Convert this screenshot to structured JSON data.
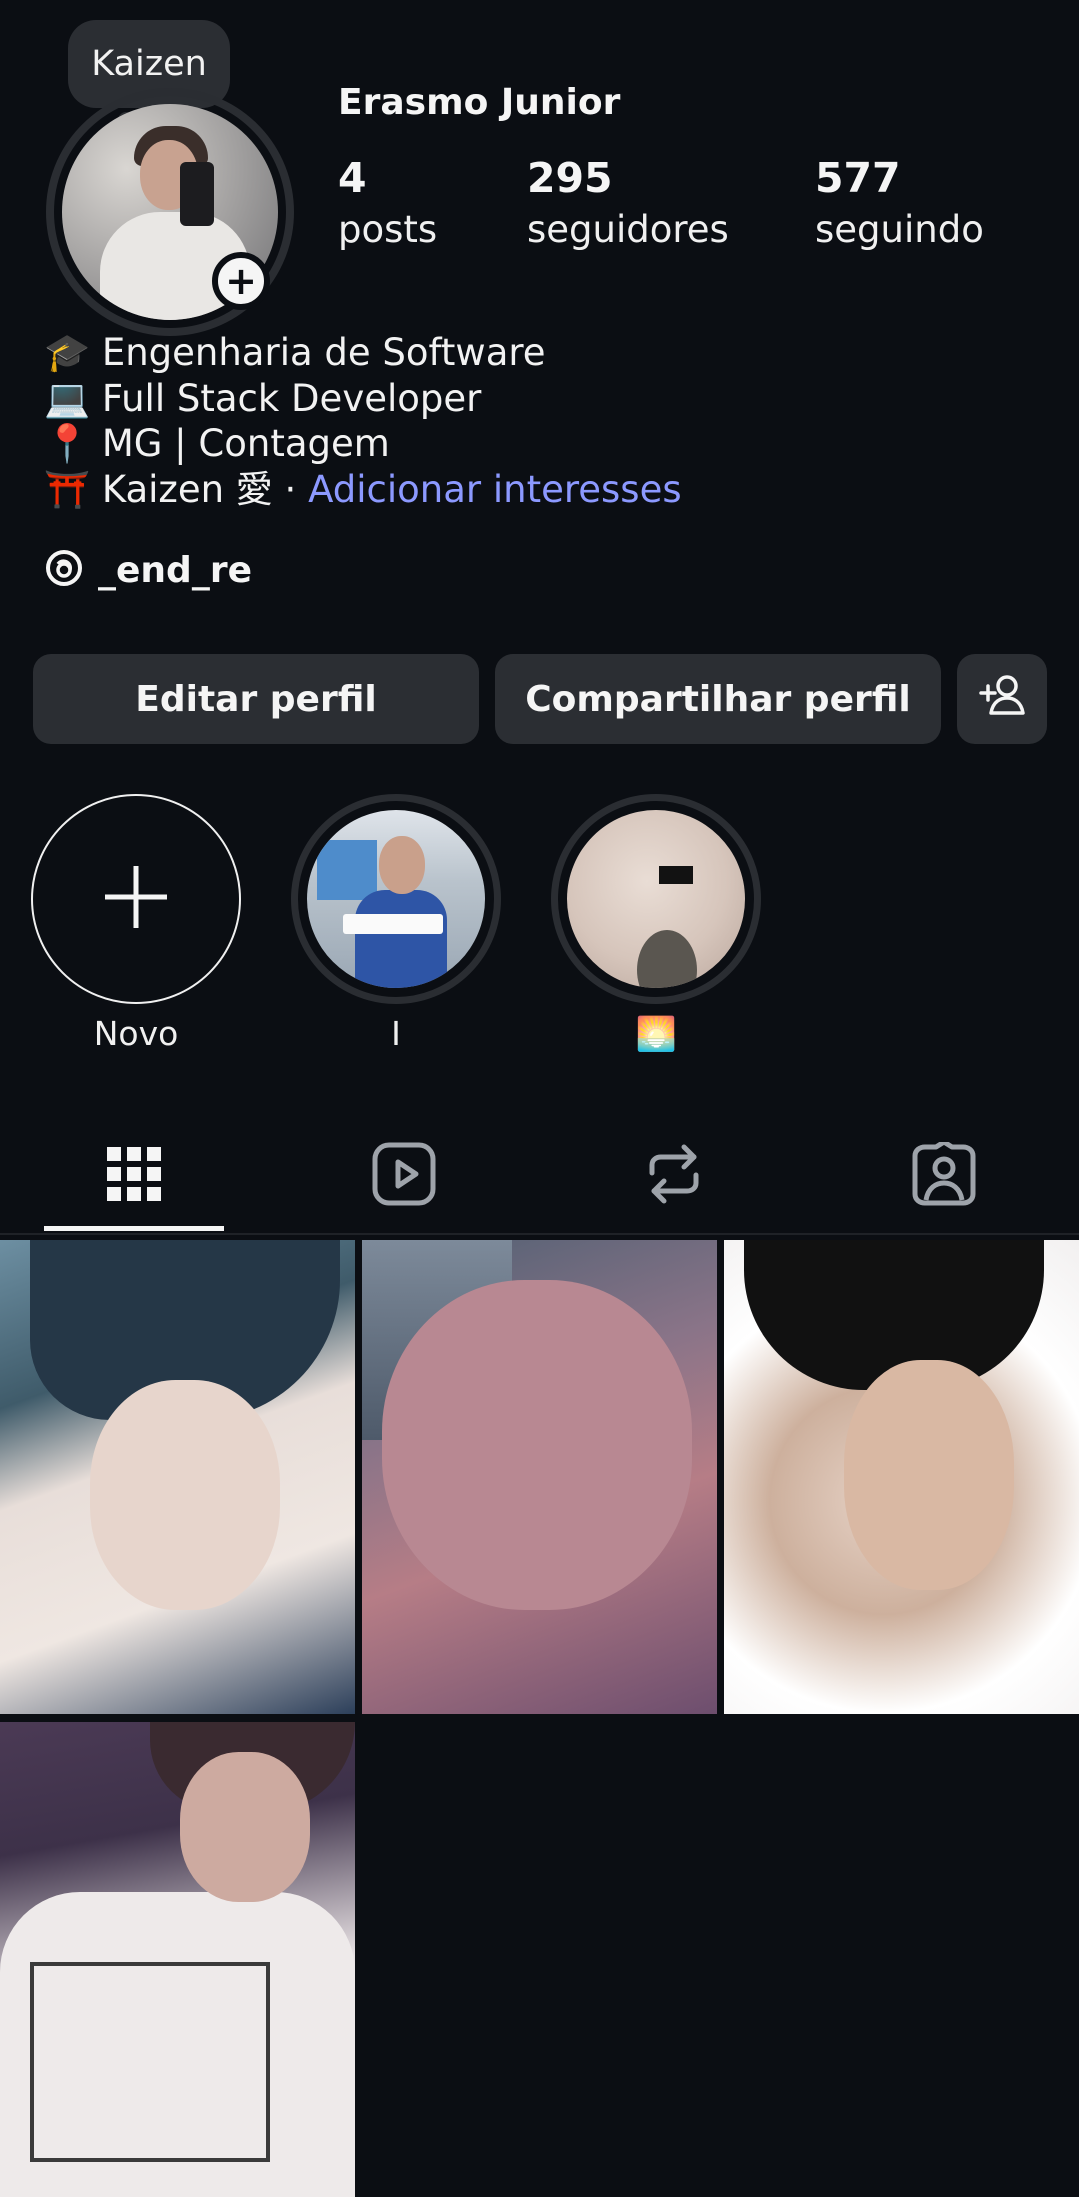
{
  "note": {
    "text": "Kaizen"
  },
  "profile": {
    "username": "Erasmo Junior",
    "stats": [
      {
        "value": "4",
        "label": "posts"
      },
      {
        "value": "295",
        "label": "seguidores"
      },
      {
        "value": "577",
        "label": "seguindo"
      }
    ],
    "bio": {
      "line1": "🎓 Engenharia de Software",
      "line2": "💻 Full Stack Developer",
      "line3": "📍 MG | Contagem",
      "line4_prefix": "⛩️ Kaizen 愛 · ",
      "line4_link": "Adicionar interesses"
    },
    "threads_handle": "_end_re"
  },
  "buttons": {
    "edit": "Editar perfil",
    "share": "Compartilhar perfil",
    "add_user_icon": "add-person-icon"
  },
  "highlights": [
    {
      "label": "Novo"
    },
    {
      "label": "I"
    },
    {
      "label": "🌅"
    }
  ],
  "tabs": [
    {
      "icon": "grid-icon",
      "active": true
    },
    {
      "icon": "reels-icon",
      "active": false
    },
    {
      "icon": "reposts-icon",
      "active": false
    },
    {
      "icon": "tagged-icon",
      "active": false
    }
  ],
  "posts_count_shown": 4,
  "colors": {
    "background": "#0b0e13",
    "button": "#2b2e33",
    "link": "#8c99ff",
    "text": "#f5f5f5"
  }
}
